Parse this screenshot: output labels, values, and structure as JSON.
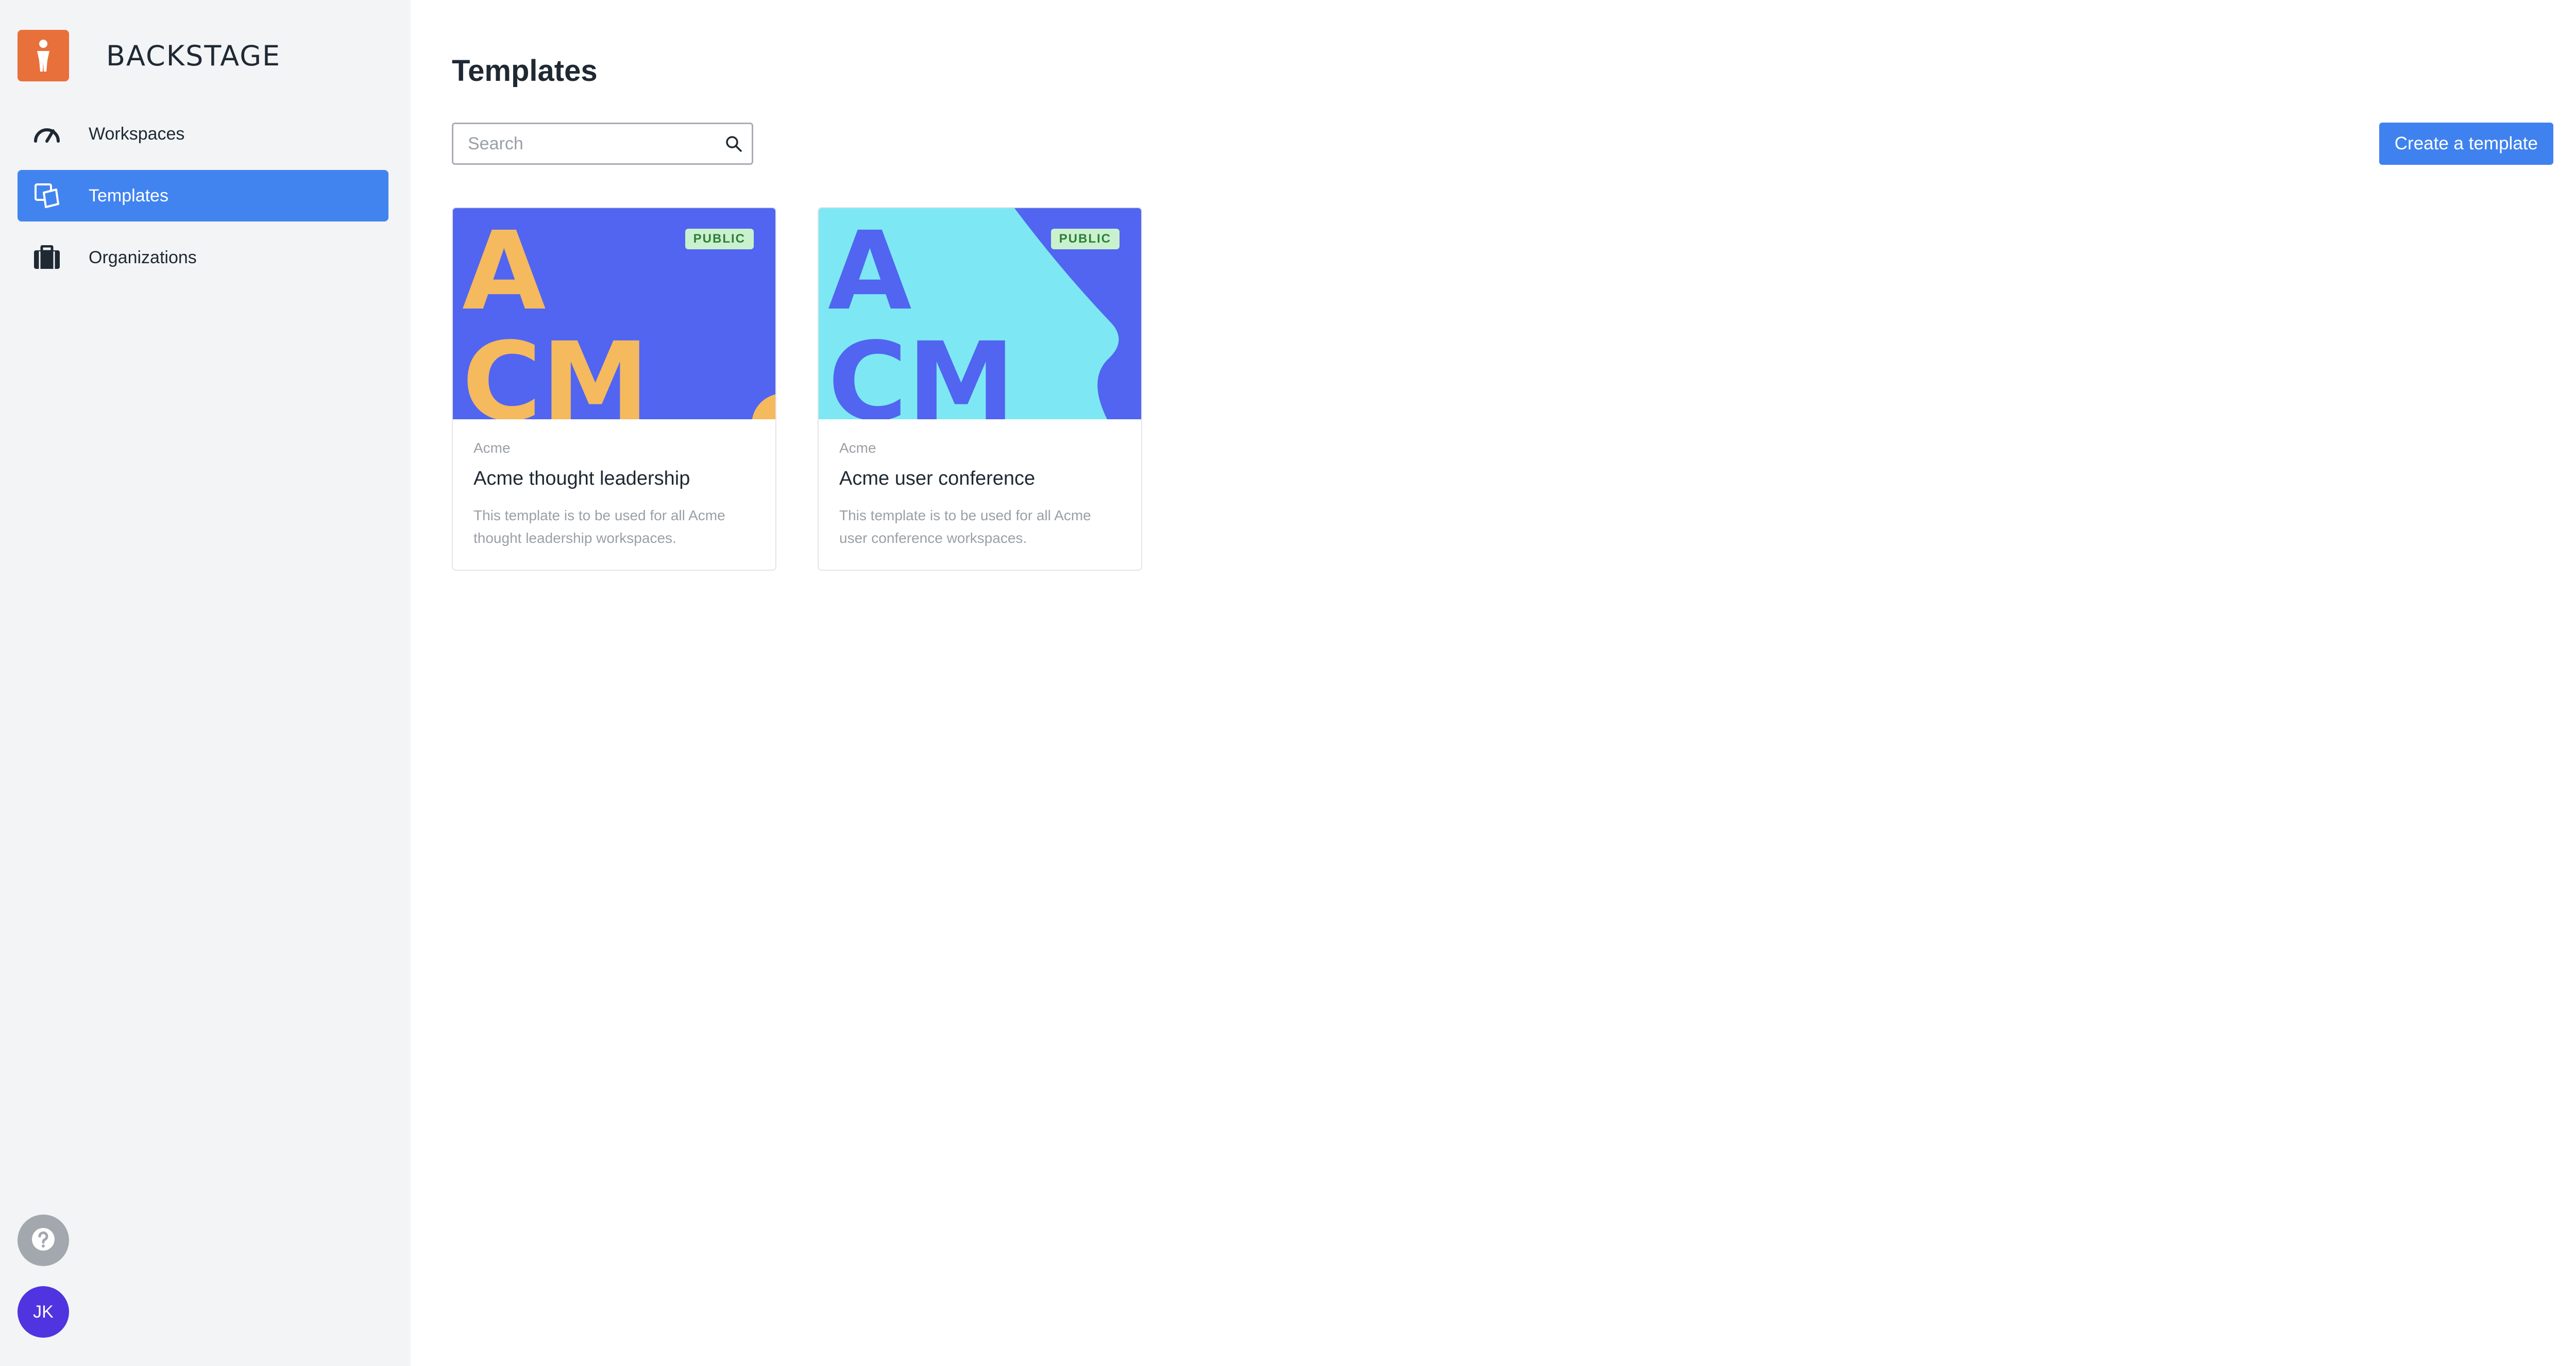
{
  "app": {
    "name": "BACKSTAGE"
  },
  "sidebar": {
    "items": [
      {
        "label": "Workspaces",
        "icon": "gauge-icon",
        "active": false
      },
      {
        "label": "Templates",
        "icon": "templates-icon",
        "active": true
      },
      {
        "label": "Organizations",
        "icon": "briefcase-icon",
        "active": false
      }
    ],
    "help_icon": "help-icon",
    "avatar_initials": "JK"
  },
  "main": {
    "title": "Templates",
    "search": {
      "placeholder": "Search",
      "value": ""
    },
    "create_button_label": "Create a template",
    "templates": [
      {
        "org": "Acme",
        "title": "Acme thought leadership",
        "description": "This template is to be used for all Acme thought leadership workspaces.",
        "badge": "PUBLIC",
        "thumb_letters": [
          "A",
          "CM"
        ]
      },
      {
        "org": "Acme",
        "title": "Acme user conference",
        "description": "This template is to be used for all Acme user conference workspaces.",
        "badge": "PUBLIC",
        "thumb_letters": [
          "A",
          "CM"
        ]
      }
    ]
  },
  "colors": {
    "accent": "#4184f0",
    "logo": "#e8703a",
    "avatar": "#4f34e0",
    "badge_bg": "#c9f1cd",
    "badge_text": "#2f7c3b",
    "thumb1_bg": "#5165f0",
    "thumb1_fg": "#f5b95e",
    "thumb2_bg": "#7de8f4",
    "thumb2_fg": "#5165f0"
  }
}
